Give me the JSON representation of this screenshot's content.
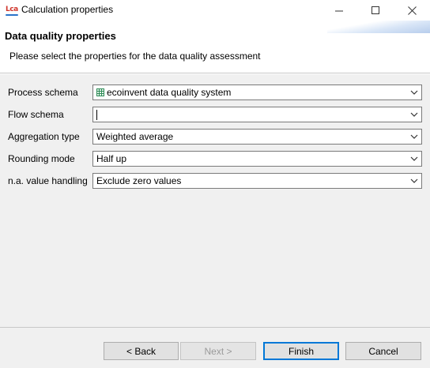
{
  "window": {
    "title": "Calculation properties",
    "app_icon_text": "LCA"
  },
  "header": {
    "title": "Data quality properties",
    "description": "Please select the properties for the data quality assessment"
  },
  "form": {
    "process_schema": {
      "label": "Process schema",
      "value": "ecoinvent data quality system",
      "icon": "table-grid-icon"
    },
    "flow_schema": {
      "label": "Flow schema",
      "value": ""
    },
    "aggregation_type": {
      "label": "Aggregation type",
      "value": "Weighted average"
    },
    "rounding_mode": {
      "label": "Rounding mode",
      "value": "Half up"
    },
    "na_value_handling": {
      "label": "n.a. value handling",
      "value": "Exclude zero values"
    }
  },
  "buttons": {
    "back": "< Back",
    "next": "Next >",
    "finish": "Finish",
    "cancel": "Cancel"
  },
  "colors": {
    "accent": "#0078d7",
    "schema_icon": "#2e8b57",
    "app_icon_red": "#d0352b",
    "app_icon_blue": "#2b73c9"
  }
}
